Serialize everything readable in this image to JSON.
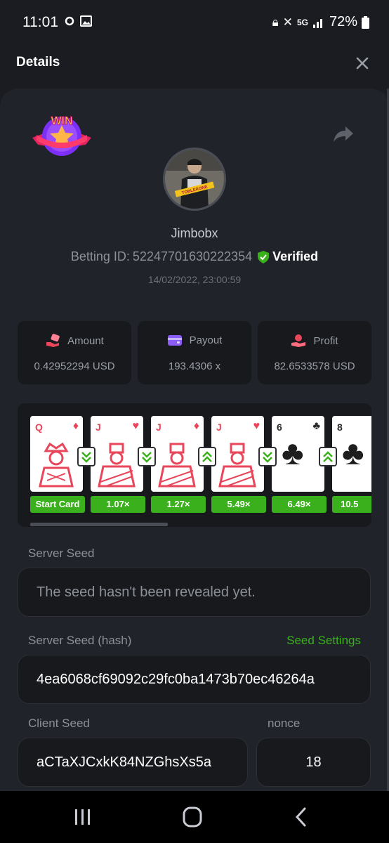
{
  "status_bar": {
    "time": "11:01",
    "battery": "72%",
    "network": "5G"
  },
  "header": {
    "title": "Details"
  },
  "bet": {
    "win_badge_text": "WIN",
    "username": "Jimbobx",
    "betting_id_label": "Betting ID:",
    "betting_id": "52247701630222354",
    "verified_label": "Verified",
    "timestamp": "14/02/2022, 23:00:59",
    "avatar_label": "TOBLERONE"
  },
  "stats": [
    {
      "label": "Amount",
      "value": "0.42952294 USD",
      "icon": "money-hand-icon",
      "color": "#e8465a"
    },
    {
      "label": "Payout",
      "value": "193.4306 x",
      "icon": "wallet-icon",
      "color": "#8b5cf6"
    },
    {
      "label": "Profit",
      "value": "82.6533578 USD",
      "icon": "coins-hand-icon",
      "color": "#e8465a"
    }
  ],
  "cards": [
    {
      "rank": "Q",
      "suit": "♦",
      "suit_color": "#e8465a",
      "multiplier": "Start Card"
    },
    {
      "rank": "J",
      "suit": "♥",
      "suit_color": "#e8465a",
      "multiplier": "1.07×"
    },
    {
      "rank": "J",
      "suit": "♦",
      "suit_color": "#e8465a",
      "multiplier": "1.27×"
    },
    {
      "rank": "J",
      "suit": "♥",
      "suit_color": "#e8465a",
      "multiplier": "5.49×"
    },
    {
      "rank": "6",
      "suit": "♣",
      "suit_color": "#2a2a2a",
      "multiplier": "6.49×"
    },
    {
      "rank": "8",
      "suit": "♣",
      "suit_color": "#2a2a2a",
      "multiplier": "10.5"
    }
  ],
  "arrows": [
    "down",
    "down",
    "up",
    "down",
    "up"
  ],
  "seeds": {
    "server_seed_label": "Server Seed",
    "server_seed_value": "The seed hasn't been revealed yet.",
    "server_hash_label": "Server Seed (hash)",
    "seed_settings_label": "Seed Settings",
    "server_hash_value": "4ea6068cf69092c29fc0ba1473b70ec46264a",
    "client_seed_label": "Client Seed",
    "client_seed_value": "aCTaXJCxkK84NZGhsXs5a",
    "nonce_label": "nonce",
    "nonce_value": "18"
  },
  "colors": {
    "accent_green": "#3ab01d",
    "background": "#1a1c21",
    "panel": "#17191d"
  }
}
